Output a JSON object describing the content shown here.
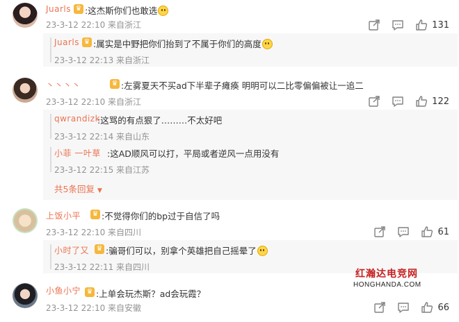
{
  "comments": [
    {
      "username": "Juarls",
      "text": ":这杰斯你们也敢选",
      "meta": "23-3-12 22:10 来自浙江",
      "likes": "131",
      "replies": [
        {
          "username": "Juarls",
          "text": ":属实是中野把你们抬到了不属于你们的高度",
          "meta": "23-3-12 22:13 来自浙江"
        }
      ]
    },
    {
      "username": "丶丶丶丶",
      "text": ":左雾夏天不买ad下半辈子瘫痪 明明可以二比零偏偏被让一追二",
      "meta": "23-3-12 22:10 来自浙江",
      "likes": "122",
      "replies": [
        {
          "username": "qwrandizk",
          "text": ":这骂的有点狠了………不太好吧",
          "meta": "23-3-12 22:14 来自山东"
        },
        {
          "username": "小菲 一叶草",
          "text": ":这AD顺风可以打，平局或者逆风一点用没有",
          "meta": "23-3-12 22:15 来自江苏"
        }
      ],
      "more_replies": "共5条回复"
    },
    {
      "username": "上饭小平",
      "text": ":不觉得你们的bp过于自信了吗",
      "meta": "23-3-12 22:10 来自四川",
      "likes": "61",
      "replies": [
        {
          "username": "小时了又",
          "text": ":骗哥们可以，别拿个英雄把自己摇晕了",
          "meta": "23-3-12 22:11 来自四川"
        }
      ]
    },
    {
      "username": "小鱼小宁",
      "text": ":上单会玩杰斯？ad会玩霞？",
      "meta": "23-3-12 22:10 来自安徽",
      "likes": "66",
      "replies": []
    }
  ],
  "watermark": {
    "cn": "红瀚达电竞网",
    "en": "HONGHANDA.COM"
  },
  "colors": {
    "username": "#eb7350",
    "meta": "#939393",
    "reply_bg": "#f7f7f7",
    "vip": "#f6b73c"
  },
  "icons": {
    "share": "share-icon",
    "comment": "comment-icon",
    "like": "thumbs-up-icon",
    "vip": "vip-badge-icon"
  }
}
